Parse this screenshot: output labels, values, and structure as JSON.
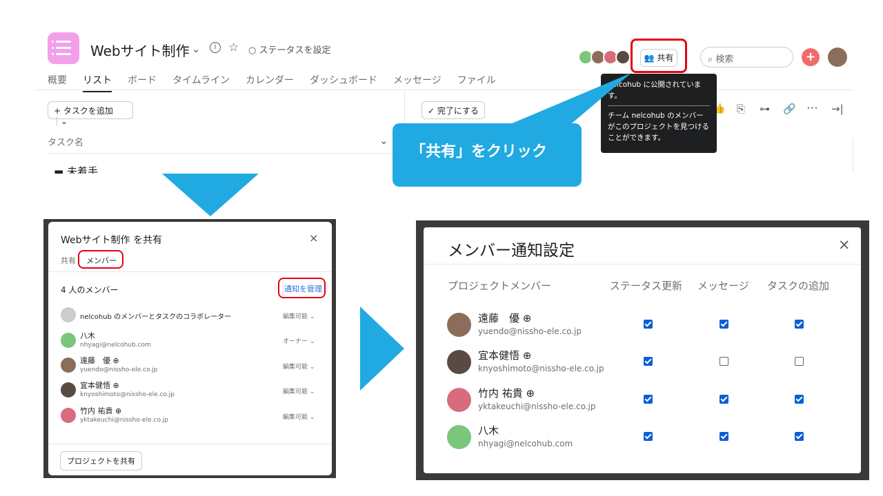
{
  "header": {
    "project_title": "Webサイト制作",
    "status_label": "ステータスを設定",
    "share_label": "共有",
    "search_placeholder": "検索"
  },
  "tabs": [
    "概要",
    "リスト",
    "ボード",
    "タイムライン",
    "カレンダー",
    "ダッシュボード",
    "メッセージ",
    "ファイル"
  ],
  "toolbar": {
    "add_task": "タスクを追加",
    "complete": "完了にする",
    "task_name_col": "タスク名",
    "partial_row": "未着手"
  },
  "tooltip": {
    "line1": "nelcohub に公開されています。",
    "line2": "チーム nelcohub のメンバーがこのプロジェクトを見つけることができます。"
  },
  "callout": "「共有」をクリック",
  "share_dialog": {
    "title": "Webサイト制作 を共有",
    "tab_share": "共有",
    "tab_members": "メンバー",
    "member_count": "4 人のメンバー",
    "manage_notifications": "通知を管理",
    "team_row": {
      "name": "nelcohub のメンバーとタスクのコラボレーター",
      "perm": "編集可能"
    },
    "members": [
      {
        "name": "八木",
        "email": "nhyagi@nelcohub.com",
        "perm": "オーナー"
      },
      {
        "name": "遠藤　優",
        "email": "yuendo@nissho-ele.co.jp",
        "perm": "編集可能"
      },
      {
        "name": "宜本健悟",
        "email": "knyoshimoto@nissho-ele.co.jp",
        "perm": "編集可能"
      },
      {
        "name": "竹内 祐貴",
        "email": "yktakeuchi@nissho-ele.co.jp",
        "perm": "編集可能"
      }
    ],
    "share_project_button": "プロジェクトを共有"
  },
  "notify_dialog": {
    "title": "メンバー通知設定",
    "col_member": "プロジェクトメンバー",
    "col_status": "ステータス更新",
    "col_message": "メッセージ",
    "col_task": "タスクの追加",
    "rows": [
      {
        "name": "遠藤　優",
        "email": "yuendo@nissho-ele.co.jp",
        "status": true,
        "message": true,
        "task": true
      },
      {
        "name": "宜本健悟",
        "email": "knyoshimoto@nissho-ele.co.jp",
        "status": true,
        "message": false,
        "task": false
      },
      {
        "name": "竹内 祐貴",
        "email": "yktakeuchi@nissho-ele.co.jp",
        "status": true,
        "message": true,
        "task": true
      },
      {
        "name": "八木",
        "email": "nhyagi@nelcohub.com",
        "status": true,
        "message": true,
        "task": true
      }
    ]
  }
}
